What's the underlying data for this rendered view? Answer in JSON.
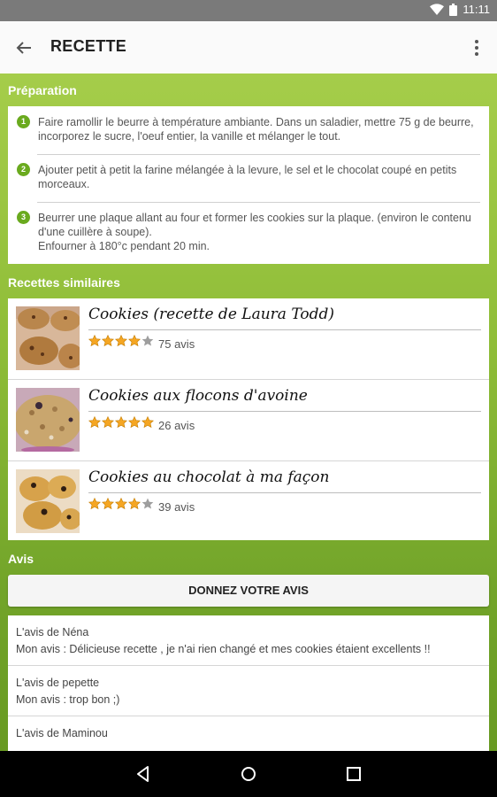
{
  "status_bar": {
    "time": "11:11"
  },
  "app_bar": {
    "title": "RECETTE"
  },
  "preparation": {
    "title": "Préparation",
    "steps": [
      {
        "num": "1",
        "text": "Faire ramollir le beurre à température ambiante. Dans un saladier, mettre 75 g de beurre, incorporez le sucre, l'oeuf entier, la vanille et mélanger le tout."
      },
      {
        "num": "2",
        "text": "Ajouter petit à petit la farine mélangée à la levure, le sel et le chocolat coupé en petits morceaux."
      },
      {
        "num": "3",
        "text": "Beurrer une plaque allant au four et former les cookies sur la plaque. (environ le contenu d'une cuillère à soupe).\nEnfourner à 180°c pendant 20 min."
      }
    ]
  },
  "similar": {
    "title": "Recettes similaires",
    "items": [
      {
        "title": "Cookies (recette de Laura Todd)",
        "rating": 4,
        "count": "75 avis"
      },
      {
        "title": "Cookies aux flocons d'avoine",
        "rating": 5,
        "count": "26 avis"
      },
      {
        "title": "Cookies au chocolat  à ma façon",
        "rating": 4,
        "count": "39 avis"
      }
    ]
  },
  "avis": {
    "title": "Avis",
    "button": "DONNEZ VOTRE AVIS",
    "reviews": [
      {
        "author": "L'avis de Néna",
        "message": "Mon avis : Délicieuse recette , je n'ai rien changé et mes cookies étaient excellents !!"
      },
      {
        "author": "L'avis de pepette",
        "message": "Mon avis : trop bon ;)"
      },
      {
        "author": "L'avis de Maminou",
        "message": ""
      }
    ]
  },
  "colors": {
    "green": "#8fbd38",
    "star": "#f5a623",
    "star_empty": "#9e9e9e"
  }
}
